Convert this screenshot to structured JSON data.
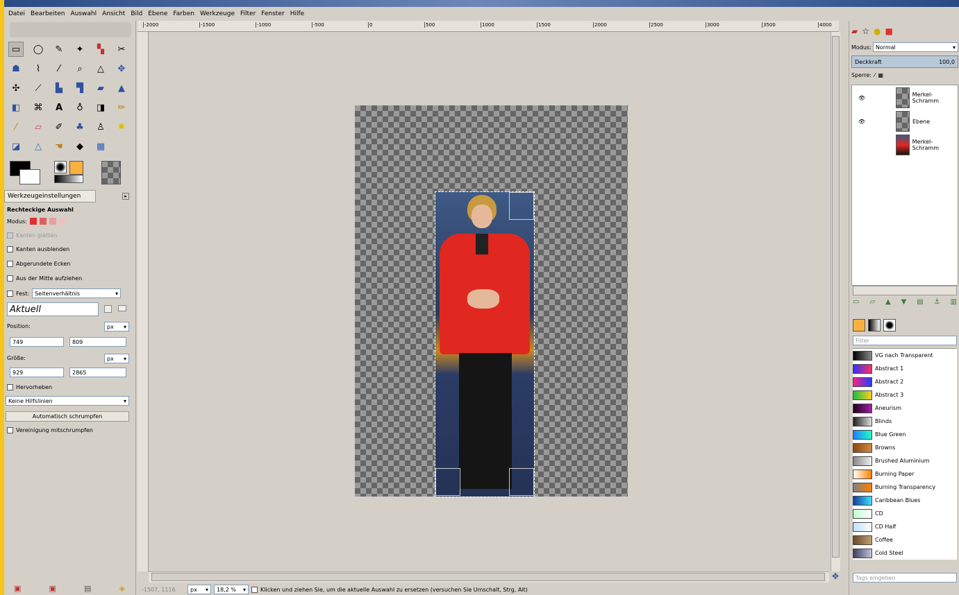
{
  "menu": [
    "Datei",
    "Bearbeiten",
    "Auswahl",
    "Ansicht",
    "Bild",
    "Ebene",
    "Farben",
    "Werkzeuge",
    "Filter",
    "Fenster",
    "Hilfe"
  ],
  "toolbox": {
    "tab_label": "Werkzeugeinstellungen",
    "tool_title": "Rechteckige Auswahl",
    "modus_label": "Modus:",
    "kanten_glaetten": "Kanten glätten",
    "kanten_ausblenden": "Kanten ausblenden",
    "abgerundete_ecken": "Abgerundete Ecken",
    "aus_der_mitte": "Aus der Mitte aufziehen",
    "fest_label": "Fest:",
    "fest_value": "Seitenverhältnis",
    "aktuell": "Aktuell",
    "position_label": "Position:",
    "position_unit": "px",
    "position_x": "749",
    "position_y": "809",
    "groesse_label": "Größe:",
    "groesse_unit": "px",
    "groesse_w": "929",
    "groesse_h": "2865",
    "hervorheben": "Hervorheben",
    "hilfslinien": "Keine Hilfslinien",
    "auto_shrink": "Automatisch schrumpfen",
    "vereinigung": "Vereinigung mitschrumpfen"
  },
  "ruler_ticks": [
    "-2000",
    "-1500",
    "-1000",
    "-500",
    "0",
    "500",
    "1000",
    "1500",
    "2000",
    "2500",
    "3000",
    "3500",
    "4000"
  ],
  "status": {
    "coords": "-1507, 1116",
    "unit": "px",
    "zoom": "18,2 %",
    "message": "Klicken und ziehen Sie, um die aktuelle Auswahl zu ersetzen (versuchen Sie Umschalt, Strg, Alt)"
  },
  "layers_panel": {
    "modus_label": "Modus:",
    "modus_value": "Normal",
    "deckkraft_label": "Deckkraft",
    "deckkraft_value": "100,0",
    "sperre_label": "Sperre:",
    "layers": [
      {
        "name": "Merkel-Schramm"
      },
      {
        "name": "Ebene"
      },
      {
        "name": "Merkel-Schramm"
      }
    ]
  },
  "gradients_panel": {
    "filter_placeholder": "Filter",
    "tags_placeholder": "Tags eingeben",
    "items": [
      {
        "name": "VG nach Transparent",
        "colors": [
          "#000000",
          "#888888"
        ]
      },
      {
        "name": "Abstract 1",
        "colors": [
          "#3030ff",
          "#ff3060"
        ]
      },
      {
        "name": "Abstract 2",
        "colors": [
          "#ff2080",
          "#2040ff"
        ]
      },
      {
        "name": "Abstract 3",
        "colors": [
          "#20c040",
          "#ffcc20"
        ]
      },
      {
        "name": "Aneurism",
        "colors": [
          "#200020",
          "#a020a0"
        ]
      },
      {
        "name": "Blinds",
        "colors": [
          "#222222",
          "#dddddd"
        ]
      },
      {
        "name": "Blue Green",
        "colors": [
          "#2080ff",
          "#20ffc0"
        ]
      },
      {
        "name": "Browns",
        "colors": [
          "#8a4a10",
          "#d08a40"
        ]
      },
      {
        "name": "Brushed Aluminium",
        "colors": [
          "#888888",
          "#eeeeee"
        ]
      },
      {
        "name": "Burning Paper",
        "colors": [
          "#ffffff",
          "#ff8000"
        ]
      },
      {
        "name": "Burning Transparency",
        "colors": [
          "#808080",
          "#ff8000"
        ]
      },
      {
        "name": "Caribbean Blues",
        "colors": [
          "#1040a0",
          "#40e0ff"
        ]
      },
      {
        "name": "CD",
        "colors": [
          "#c0ffd0",
          "#ffffff"
        ]
      },
      {
        "name": "CD Half",
        "colors": [
          "#c0e0ff",
          "#ffffff"
        ]
      },
      {
        "name": "Coffee",
        "colors": [
          "#6a4a2a",
          "#c0a070"
        ]
      },
      {
        "name": "Cold Steel",
        "colors": [
          "#404060",
          "#c0c0e0"
        ]
      }
    ]
  }
}
